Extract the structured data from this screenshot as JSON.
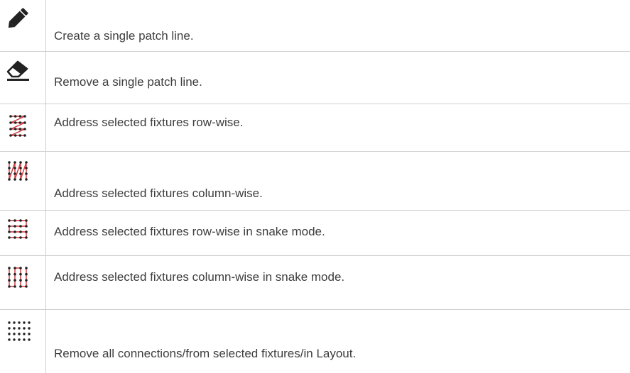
{
  "rows": [
    {
      "icon": "pencil-icon",
      "text": "Create a single patch line."
    },
    {
      "icon": "eraser-icon",
      "text": "Remove a single patch line."
    },
    {
      "icon": "row-wise-address-icon",
      "text": "Address selected fixtures row-wise."
    },
    {
      "icon": "column-wise-address-icon",
      "text": "Address selected fixtures column-wise."
    },
    {
      "icon": "row-wise-snake-address-icon",
      "text": "Address selected fixtures row-wise in snake mode."
    },
    {
      "icon": "column-wise-snake-address-icon",
      "text": "Address selected fixtures column-wise in snake mode."
    },
    {
      "icon": "remove-connections-icon",
      "text": "Remove all connections/from selected fixtures/in Layout."
    }
  ],
  "colors": {
    "text": "#3d3d3d",
    "icon_dark": "#222222",
    "icon_accent": "#d0343a",
    "border": "#cfcfcf"
  }
}
